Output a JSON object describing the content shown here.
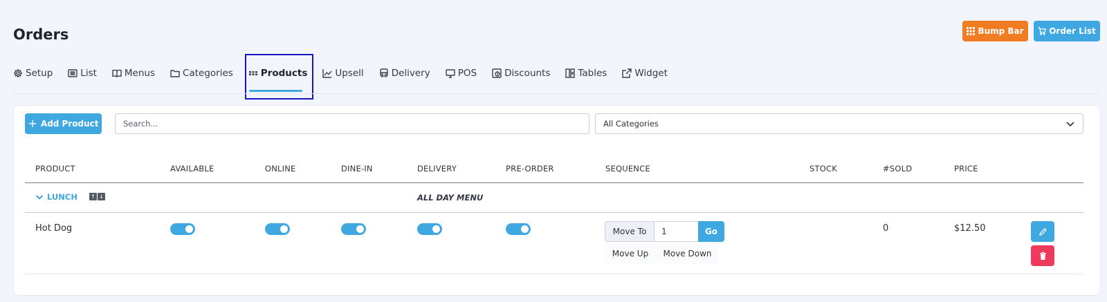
{
  "page": {
    "title": "Orders"
  },
  "header_buttons": {
    "bump_bar": "Bump Bar",
    "order_list": "Order List"
  },
  "tabs": [
    {
      "label": "Setup",
      "icon": "gear-icon"
    },
    {
      "label": "List",
      "icon": "list-icon"
    },
    {
      "label": "Menus",
      "icon": "book-icon"
    },
    {
      "label": "Categories",
      "icon": "folder-icon"
    },
    {
      "label": "Products",
      "icon": "grid-icon",
      "active": true
    },
    {
      "label": "Upsell",
      "icon": "chart-up-icon"
    },
    {
      "label": "Delivery",
      "icon": "bus-icon"
    },
    {
      "label": "POS",
      "icon": "monitor-icon"
    },
    {
      "label": "Discounts",
      "icon": "discount-icon"
    },
    {
      "label": "Tables",
      "icon": "layout-icon"
    },
    {
      "label": "Widget",
      "icon": "external-link-icon"
    }
  ],
  "toolbar": {
    "add_product": "Add Product",
    "search_placeholder": "Search...",
    "category_select": "All Categories"
  },
  "table": {
    "columns": [
      "PRODUCT",
      "AVAILABLE",
      "ONLINE",
      "DINE-IN",
      "DELIVERY",
      "PRE-ORDER",
      "SEQUENCE",
      "STOCK",
      "#SOLD",
      "PRICE"
    ],
    "group": {
      "name": "LUNCH",
      "menu": "ALL DAY MENU"
    },
    "rows": [
      {
        "product": "Hot Dog",
        "available": true,
        "online": true,
        "dine_in": true,
        "delivery": true,
        "pre_order": true,
        "sequence_value": "1",
        "stock": "",
        "sold": "0",
        "price": "$12.50"
      }
    ]
  },
  "sequence_controls": {
    "move_to": "Move To",
    "go": "Go",
    "move_up": "Move Up",
    "move_down": "Move Down"
  },
  "colors": {
    "accent": "#40a8e0",
    "bump_bar": "#f27c22",
    "delete": "#ee3a5d",
    "focus_outline": "#1515c8"
  }
}
